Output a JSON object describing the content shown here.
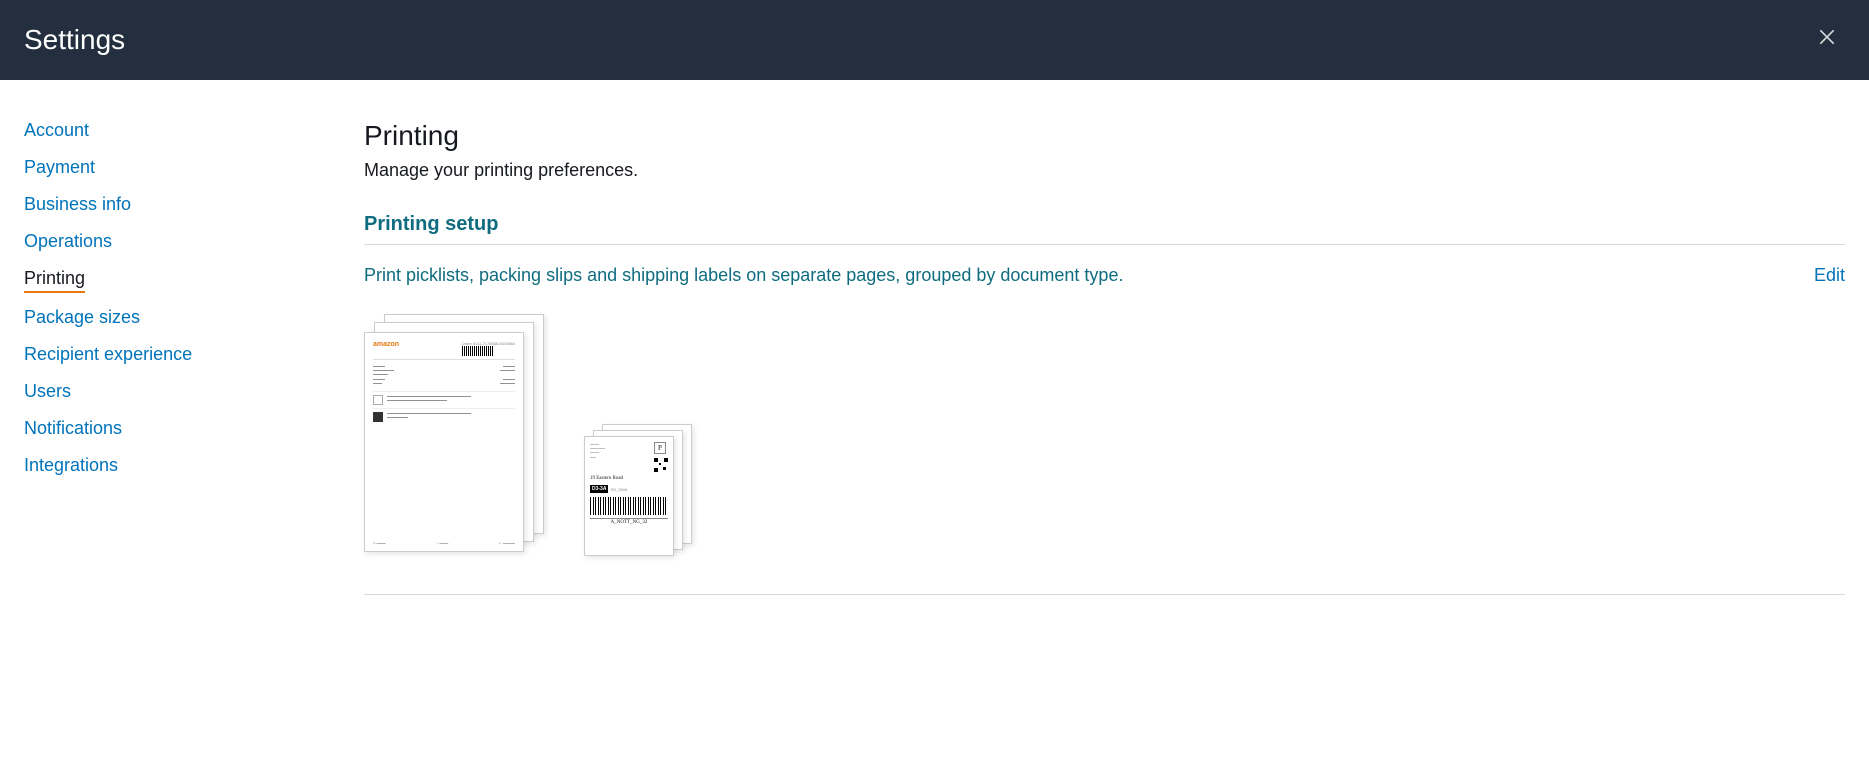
{
  "header": {
    "title": "Settings"
  },
  "sidebar": {
    "items": [
      {
        "label": "Account",
        "active": false
      },
      {
        "label": "Payment",
        "active": false
      },
      {
        "label": "Business info",
        "active": false
      },
      {
        "label": "Operations",
        "active": false
      },
      {
        "label": "Printing",
        "active": true
      },
      {
        "label": "Package sizes",
        "active": false
      },
      {
        "label": "Recipient experience",
        "active": false
      },
      {
        "label": "Users",
        "active": false
      },
      {
        "label": "Notifications",
        "active": false
      },
      {
        "label": "Integrations",
        "active": false
      }
    ]
  },
  "main": {
    "title": "Printing",
    "subtitle": "Manage your printing preferences.",
    "section_title": "Printing setup",
    "description": "Print picklists, packing slips and shipping labels on separate pages, grouped by document type.",
    "edit_label": "Edit"
  },
  "preview": {
    "packing_slip": {
      "logo": "amazon",
      "order_prefix": "Order #111-7175366-6519884",
      "address_label": "19 Eastern Road",
      "code_box": "D3-3A",
      "code_suffix": "SG_0006",
      "bottom_text": "A_NOTT_NG_32"
    },
    "label": {
      "p_marker": "P"
    }
  }
}
